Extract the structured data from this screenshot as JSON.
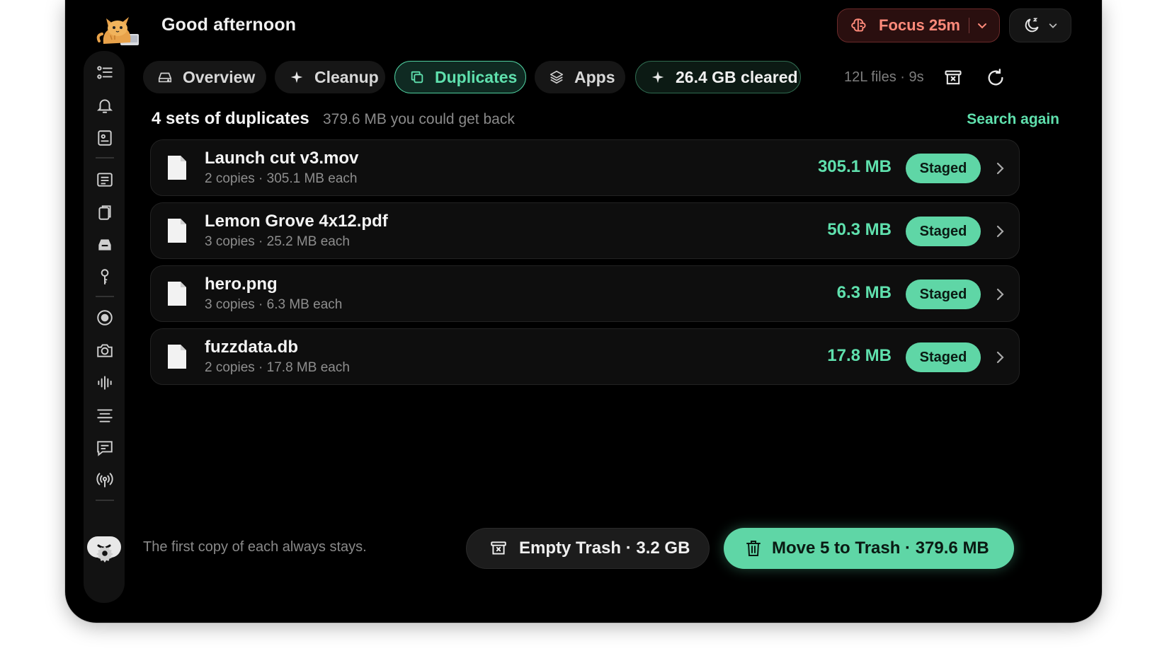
{
  "header": {
    "greeting": "Good afternoon",
    "focus_label": "Focus 25m"
  },
  "tabs": [
    {
      "label": "Overview",
      "icon": "drive-icon"
    },
    {
      "label": "Cleanup",
      "icon": "sparkle-icon"
    },
    {
      "label": "Duplicates",
      "icon": "copy-icon",
      "active": true
    },
    {
      "label": "Apps",
      "icon": "layers-icon"
    },
    {
      "label": "26.4 GB cleared",
      "icon": "sparkle-icon"
    }
  ],
  "toolbar": {
    "meta": "12L files · 9s"
  },
  "section": {
    "title": "4 sets of duplicates",
    "subtitle": "379.6 MB you could get back",
    "search_again": "Search again"
  },
  "duplicates": [
    {
      "name": "Launch cut v3.mov",
      "copies": "2 copies · 305.1 MB each",
      "size": "305.1 MB",
      "status": "Staged"
    },
    {
      "name": "Lemon Grove 4x12.pdf",
      "copies": "3 copies · 25.2 MB each",
      "size": "50.3 MB",
      "status": "Staged"
    },
    {
      "name": "hero.png",
      "copies": "3 copies · 6.3 MB each",
      "size": "6.3 MB",
      "status": "Staged"
    },
    {
      "name": "fuzzdata.db",
      "copies": "2 copies · 17.8 MB each",
      "size": "17.8 MB",
      "status": "Staged"
    }
  ],
  "footer": {
    "note": "The first copy of each always stays.",
    "empty_trash": "Empty Trash · 3.2 GB",
    "move_to_trash": "Move 5 to Trash · 379.6 MB"
  },
  "colors": {
    "accent": "#5fd6a6",
    "focus": "#ff8a7a",
    "background": "#000000"
  }
}
